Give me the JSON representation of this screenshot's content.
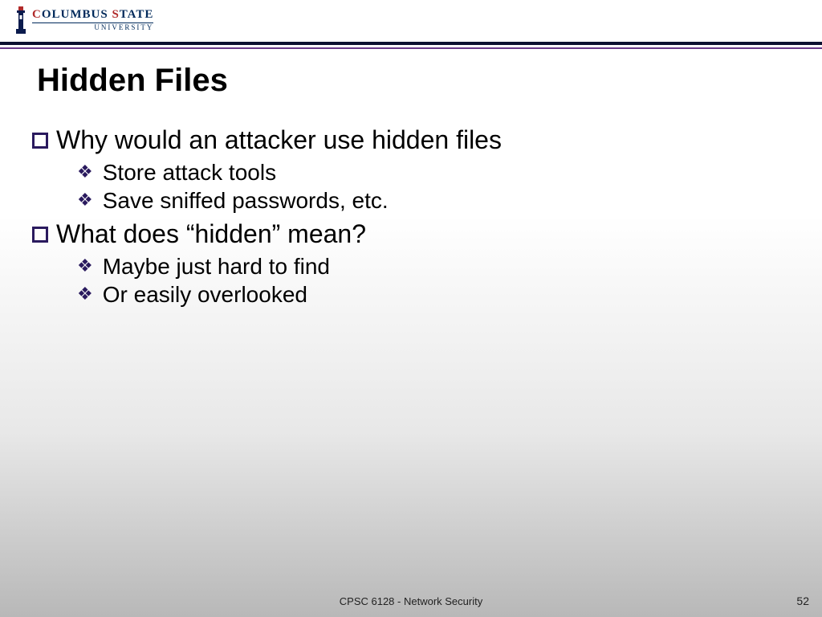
{
  "logo": {
    "main_a": "C",
    "main_b": "OLUMBUS ",
    "main_c": "S",
    "main_d": "TATE",
    "sub": "UNIVERSITY"
  },
  "title": "Hidden Files",
  "bullets": [
    {
      "text": "Why would an attacker use hidden files",
      "children": [
        "Store attack tools",
        "Save sniffed passwords, etc."
      ]
    },
    {
      "text": "What does “hidden” mean?",
      "children": [
        "Maybe just hard to find",
        "Or easily overlooked"
      ]
    }
  ],
  "footer": "CPSC 6128 - Network Security",
  "page": "52"
}
